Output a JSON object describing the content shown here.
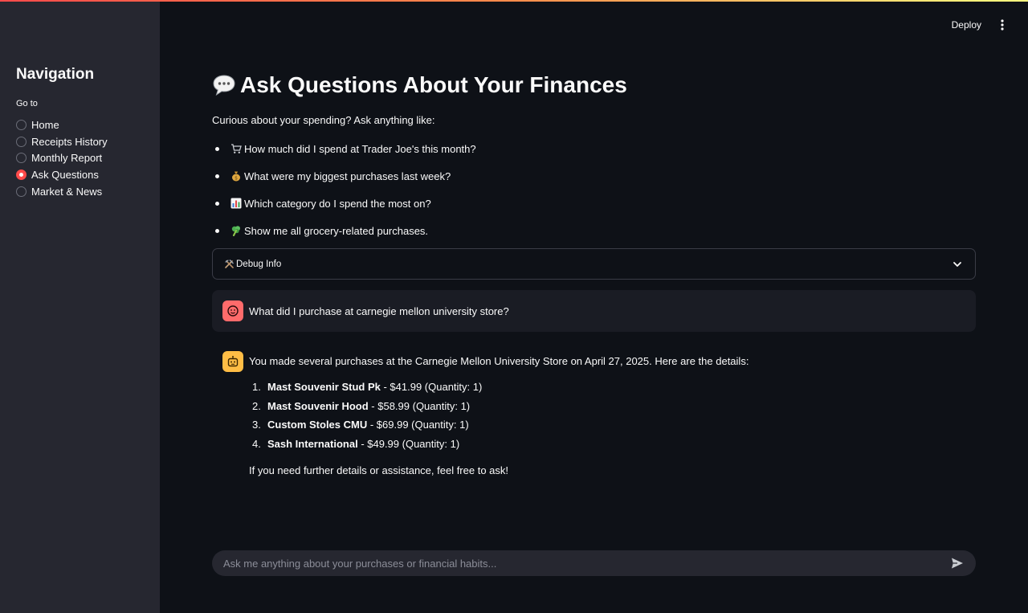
{
  "header": {
    "deploy_label": "Deploy",
    "menu_icon": "kebab-menu-icon"
  },
  "sidebar": {
    "title": "Navigation",
    "caption": "Go to",
    "items": [
      {
        "label": "Home",
        "selected": false
      },
      {
        "label": "Receipts History",
        "selected": false
      },
      {
        "label": "Monthly Report",
        "selected": false
      },
      {
        "label": "Ask Questions",
        "selected": true
      },
      {
        "label": "Market & News",
        "selected": false
      }
    ]
  },
  "main": {
    "title_icon": "speech-bubble-icon",
    "title": "Ask Questions About Your Finances",
    "intro": "Curious about your spending? Ask anything like:",
    "examples": [
      {
        "icon": "shopping-cart-icon",
        "text": "How much did I spend at Trader Joe's this month?"
      },
      {
        "icon": "money-bag-icon",
        "text": "What were my biggest purchases last week?"
      },
      {
        "icon": "bar-chart-icon",
        "text": "Which category do I spend the most on?"
      },
      {
        "icon": "broccoli-icon",
        "text": "Show me all grocery-related purchases."
      }
    ],
    "debug": {
      "icon": "hammer-pick-icon",
      "label": "Debug Info"
    }
  },
  "chat": {
    "user_message": "What did I purchase at carnegie mellon university store?",
    "assistant": {
      "intro": "You made several purchases at the Carnegie Mellon University Store on April 27, 2025. Here are the details:",
      "items": [
        {
          "num": "1.",
          "name": "Mast Souvenir Stud Pk",
          "detail": " - $41.99 (Quantity: 1)"
        },
        {
          "num": "2.",
          "name": "Mast Souvenir Hood",
          "detail": " - $58.99 (Quantity: 1)"
        },
        {
          "num": "3.",
          "name": "Custom Stoles CMU",
          "detail": " - $69.99 (Quantity: 1)"
        },
        {
          "num": "4.",
          "name": "Sash International",
          "detail": " - $49.99 (Quantity: 1)"
        }
      ],
      "outro": "If you need further details or assistance, feel free to ask!"
    },
    "input_placeholder": "Ask me anything about your purchases or financial habits..."
  },
  "colors": {
    "background": "#0e1117",
    "sidebar": "#262730",
    "accent": "#ff4b4b",
    "user_avatar": "#ff6b6b",
    "bot_avatar": "#ffbd45"
  }
}
